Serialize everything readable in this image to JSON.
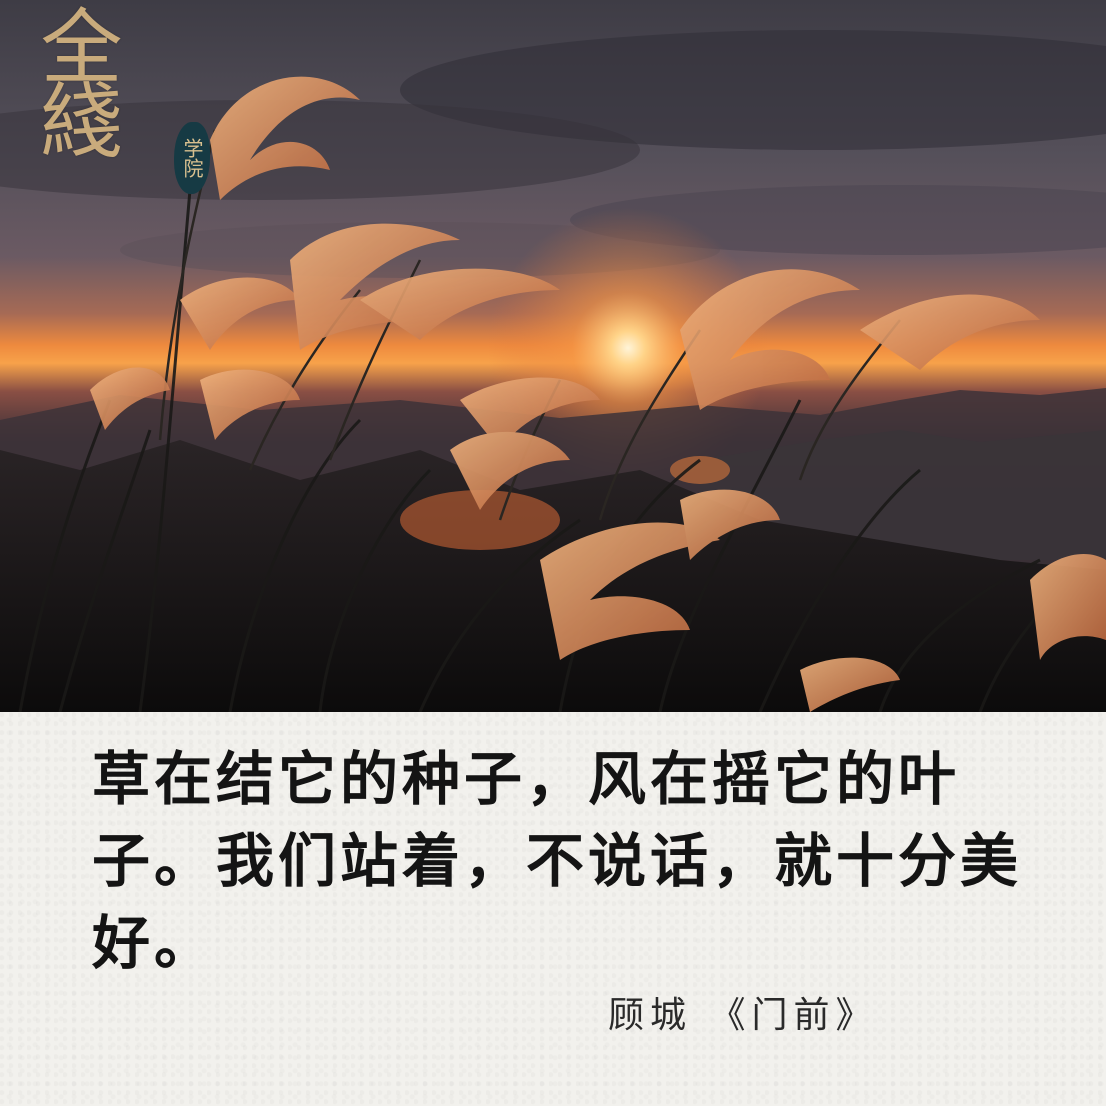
{
  "logo": {
    "main_text": "全綫",
    "seal_text": "学院"
  },
  "quote": {
    "text": "草在结它的种子，风在摇它的叶子。我们站着，不说话，就十分美好。"
  },
  "attribution": {
    "text": "顾城 《门前》"
  },
  "colors": {
    "quote_text": "#141414",
    "logo_gold": "#c9ab7c",
    "seal_bg": "#163a44",
    "paper_bg": "#f2f1ed"
  }
}
